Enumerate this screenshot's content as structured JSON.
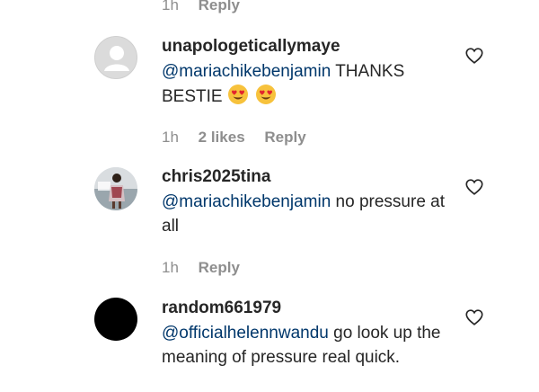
{
  "top_meta": {
    "time": "1h",
    "reply_label": "Reply"
  },
  "comments": [
    {
      "username": "unapologeticallymaye",
      "mention": "@mariachikebenjamin",
      "text_before_emoji": "THANKS BESTIE",
      "emojis": [
        "heart-eyes-emoji",
        "heart-eyes-emoji"
      ],
      "time": "1h",
      "likes": "2 likes",
      "reply_label": "Reply",
      "avatar": "default-avatar"
    },
    {
      "username": "chris2025tina",
      "mention": "@mariachikebenjamin",
      "text": "no pressure at all",
      "time": "1h",
      "reply_label": "Reply",
      "avatar": "photo-avatar"
    },
    {
      "username": "random661979",
      "mention": "@officialhelennwandu",
      "text": "go look up the meaning of pressure real quick.",
      "avatar": "black-avatar"
    }
  ],
  "colors": {
    "text": "#262626",
    "muted": "#8e8e8e",
    "mention": "#00376b"
  }
}
